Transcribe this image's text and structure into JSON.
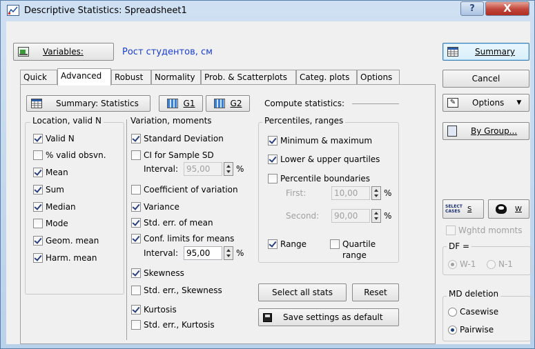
{
  "window": {
    "title": "Descriptive Statistics: Spreadsheet1",
    "help_label": "?",
    "close_label": "X"
  },
  "variables": {
    "button_label": "Variables:",
    "value": "Рост студентов, см"
  },
  "tabs": [
    {
      "label": "Quick"
    },
    {
      "label": "Advanced",
      "active": true
    },
    {
      "label": "Robust"
    },
    {
      "label": "Normality"
    },
    {
      "label": "Prob. & Scatterplots"
    },
    {
      "label": "Categ. plots"
    },
    {
      "label": "Options"
    }
  ],
  "toolbar": {
    "summary_stats_label": "Summary: Statistics",
    "g1_label": "G1",
    "g2_label": "G2",
    "compute_label": "Compute statistics:"
  },
  "location": {
    "title": "Location, valid N",
    "items": [
      {
        "label": "Valid N",
        "checked": true
      },
      {
        "label": "% valid obsvn.",
        "checked": false
      },
      {
        "label": "Mean",
        "checked": true
      },
      {
        "label": "Sum",
        "checked": true
      },
      {
        "label": "Median",
        "checked": true
      },
      {
        "label": "Mode",
        "checked": false
      },
      {
        "label": "Geom. mean",
        "checked": true
      },
      {
        "label": "Harm. mean",
        "checked": true
      }
    ]
  },
  "variation": {
    "title": "Variation, moments",
    "std_dev": "Standard Deviation",
    "ci_sd": "CI for Sample SD",
    "interval_label": "Interval:",
    "ci_sd_interval": "95,00",
    "percent": "%",
    "coef_var": "Coefficient of variation",
    "variance": "Variance",
    "se_mean": "Std. err. of mean",
    "conf_limits": "Conf. limits for means",
    "conf_interval": "95,00",
    "skewness": "Skewness",
    "se_skewness": "Std. err., Skewness",
    "kurtosis": "Kurtosis",
    "se_kurtosis": "Std. err., Kurtosis"
  },
  "percentiles": {
    "title": "Percentiles, ranges",
    "min_max": "Minimum & maximum",
    "quartiles": "Lower & upper quartiles",
    "boundaries": "Percentile boundaries",
    "first_label": "First:",
    "first_value": "10,00",
    "second_label": "Second:",
    "second_value": "90,00",
    "percent": "%",
    "range": "Range",
    "quartile_range_1": "Quartile",
    "quartile_range_2": "range"
  },
  "bottom_buttons": {
    "select_all": "Select all stats",
    "reset": "Reset",
    "save_default": "Save settings as default"
  },
  "right_panel": {
    "summary": "Summary",
    "cancel": "Cancel",
    "options": "Options",
    "by_group": "By Group...",
    "select_cases_icon_text": "SELECT CASES",
    "s_label": "S",
    "w_label": "W",
    "wghtd_momnts": "Wghtd momnts",
    "df_label": "DF =",
    "w1": "W-1",
    "n1": "N-1",
    "md_title": "MD deletion",
    "casewise": "Casewise",
    "pairwise": "Pairwise"
  }
}
